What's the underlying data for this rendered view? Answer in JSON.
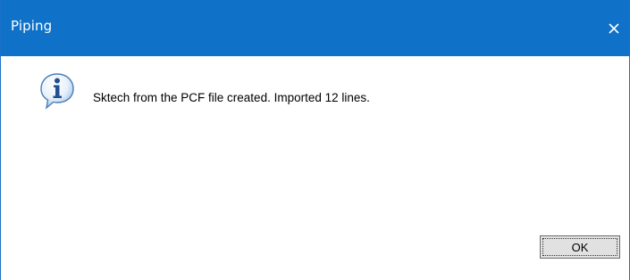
{
  "window": {
    "title": "Piping",
    "close_icon": "close-icon",
    "titlebar_color": "#0f71c7"
  },
  "content": {
    "icon": "info-icon",
    "message": "Sktech from the PCF file created. Imported 12 lines."
  },
  "buttons": {
    "ok_label": "OK"
  }
}
